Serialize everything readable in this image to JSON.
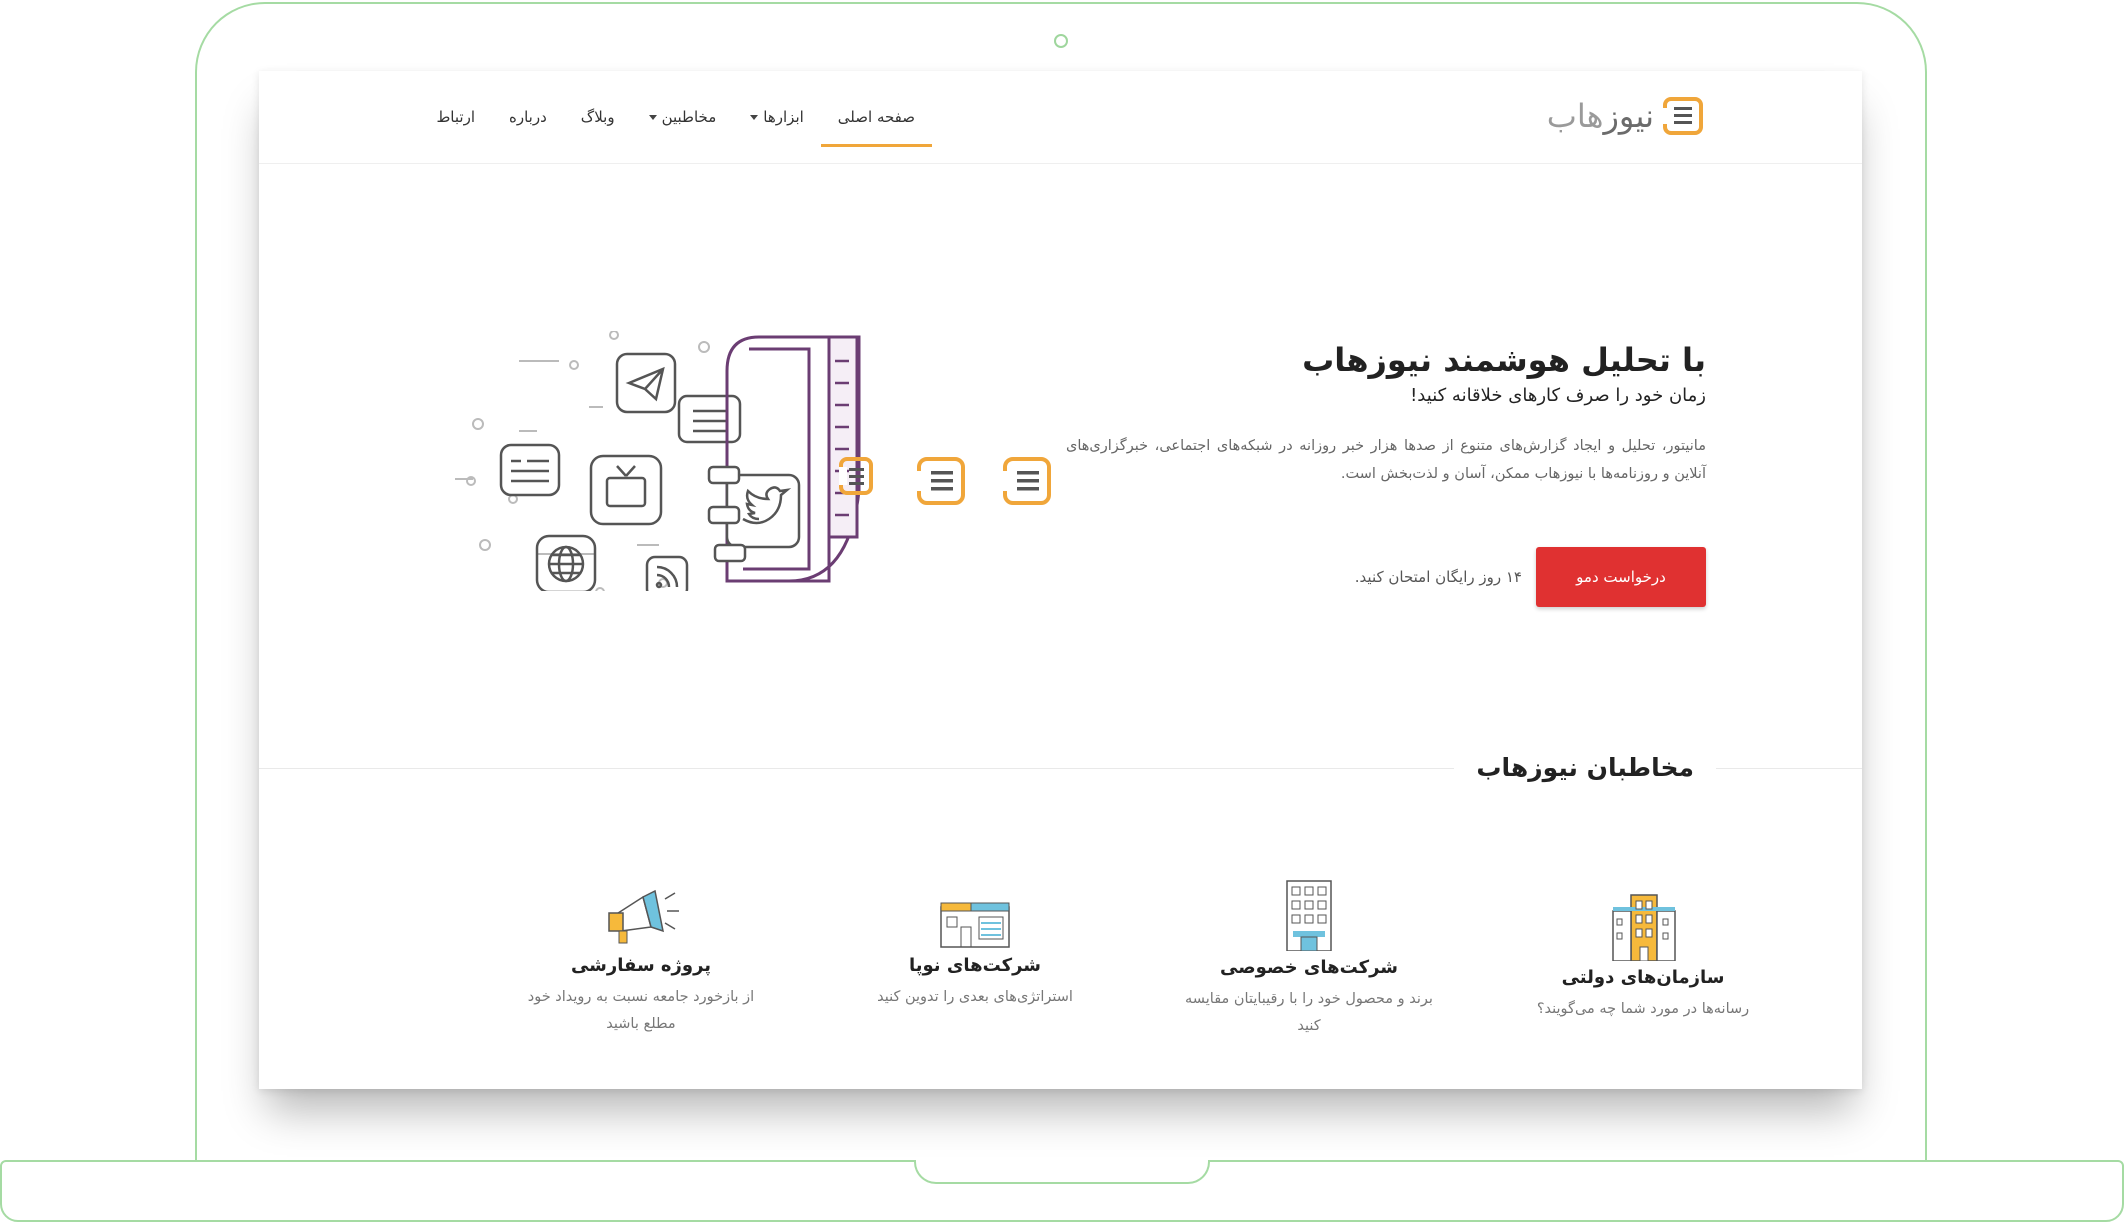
{
  "brand": {
    "logo_text_1": "نیوز",
    "logo_text_2": "هاب",
    "colors": {
      "accent": "#f0a63a",
      "cta": "#e03131",
      "frame": "#a5dba3",
      "art_stroke": "#6b3d73"
    }
  },
  "nav": {
    "items": [
      {
        "label": "صفحه اصلی",
        "active": true,
        "dropdown": false
      },
      {
        "label": "ابزارها",
        "active": false,
        "dropdown": true
      },
      {
        "label": "مخاطبین",
        "active": false,
        "dropdown": true
      },
      {
        "label": "وبلاگ",
        "active": false,
        "dropdown": false
      },
      {
        "label": "درباره",
        "active": false,
        "dropdown": false
      },
      {
        "label": "ارتباط",
        "active": false,
        "dropdown": false
      }
    ]
  },
  "hero": {
    "title": "با تحلیل هوشمند نیوزهاب",
    "subtitle": "زمان خود را صرف کارهای خلاقانه کنید!",
    "description": "مانیتور، تحلیل و ایجاد گزارش‌های متنوع از صدها هزار خبر روزانه در شبکه‌های اجتماعی، خبرگزاری‌های آنلاین و روزنامه‌ها با نیوزهاب ممکن، آسان و لذت‌بخش است.",
    "cta_label": "درخواست دمو",
    "cta_note": "۱۴ روز رایگان امتحان کنید.",
    "art_icons": [
      "telegram-icon",
      "news-icon",
      "tv-icon",
      "globe-icon",
      "rss-icon",
      "twitter-icon",
      "chat-icon"
    ]
  },
  "audience": {
    "title": "مخاطبان نیوزهاب",
    "cards": [
      {
        "title": "سازمان‌های دولتی",
        "desc": "رسانه‌ها در مورد شما چه می‌گویند؟",
        "icon": "government-building-icon"
      },
      {
        "title": "شرکت‌های خصوصی",
        "desc": "برند و محصول خود را با رقیبایتان مقایسه کنید",
        "icon": "office-tower-icon"
      },
      {
        "title": "شرکت‌های نوپا",
        "desc": "استراتژی‌های بعدی را تدوین کنید",
        "icon": "startup-building-icon"
      },
      {
        "title": "پروژه سفارشی",
        "desc": "از بازخورد جامعه نسبت به رویداد خود مطلع باشید",
        "icon": "megaphone-icon"
      }
    ]
  }
}
